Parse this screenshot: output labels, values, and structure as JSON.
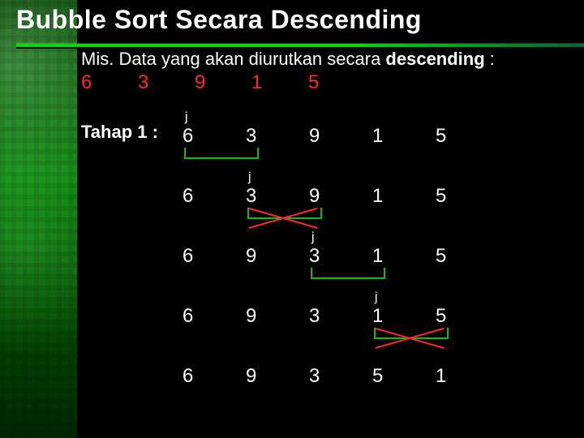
{
  "title": "Bubble Sort Secara Descending",
  "intro_prefix": "Mis. Data yang akan diurutkan secara ",
  "intro_bold": "descending",
  "intro_suffix": " :",
  "initial": [
    "6",
    "3",
    "9",
    "1",
    "5"
  ],
  "stage_label": "Tahap 1 :",
  "j_label": "j",
  "steps": [
    {
      "values": [
        "6",
        "3",
        "9",
        "1",
        "5"
      ],
      "j_col": 0,
      "bracket": "b01",
      "cross": null
    },
    {
      "values": [
        "6",
        "3",
        "9",
        "1",
        "5"
      ],
      "j_col": 1,
      "bracket": "b12",
      "cross": "b12"
    },
    {
      "values": [
        "6",
        "9",
        "3",
        "1",
        "5"
      ],
      "j_col": 2,
      "bracket": "b23",
      "cross": null
    },
    {
      "values": [
        "6",
        "9",
        "3",
        "1",
        "5"
      ],
      "j_col": 3,
      "bracket": "b34",
      "cross": "b34"
    },
    {
      "values": [
        "6",
        "9",
        "3",
        "5",
        "1"
      ],
      "j_col": null,
      "bracket": null,
      "cross": null
    }
  ],
  "chart_data": {
    "type": "table",
    "title": "Bubble Sort Descending — Tahap 1 pass trace",
    "initial_array": [
      6,
      3,
      9,
      1,
      5
    ],
    "direction": "descending",
    "rows": [
      {
        "array": [
          6,
          3,
          9,
          1,
          5
        ],
        "compare_index_j": 0,
        "swap": false
      },
      {
        "array": [
          6,
          3,
          9,
          1,
          5
        ],
        "compare_index_j": 1,
        "swap": true
      },
      {
        "array": [
          6,
          9,
          3,
          1,
          5
        ],
        "compare_index_j": 2,
        "swap": false
      },
      {
        "array": [
          6,
          9,
          3,
          1,
          5
        ],
        "compare_index_j": 3,
        "swap": true
      },
      {
        "array": [
          6,
          9,
          3,
          5,
          1
        ],
        "compare_index_j": null,
        "swap": null
      }
    ]
  }
}
